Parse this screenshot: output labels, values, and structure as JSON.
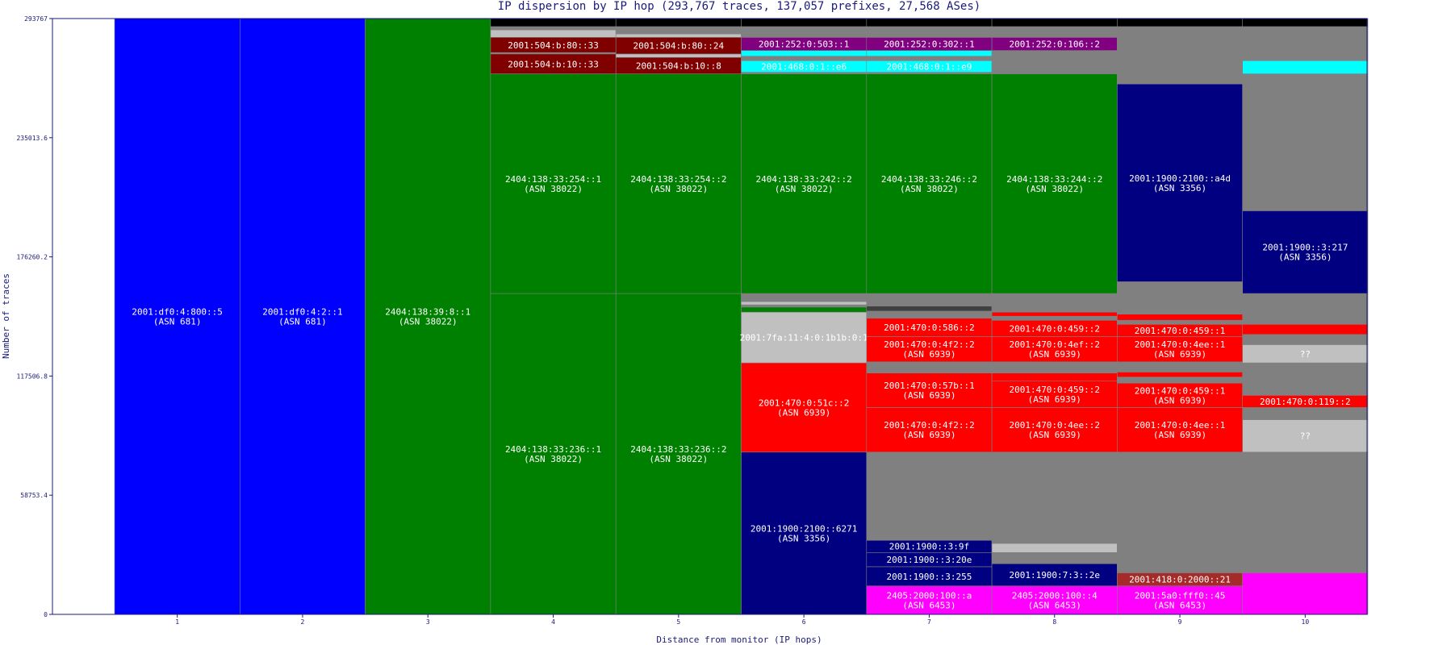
{
  "chart_data": {
    "type": "bar",
    "title": "IP dispersion by IP hop (293,767 traces, 137,057 prefixes, 27,568 ASes)",
    "xlabel": "Distance from monitor (IP hops)",
    "ylabel": "Number of traces",
    "ylim": [
      0,
      293767
    ],
    "yticks": [
      "0",
      "58753.4",
      "117506.8",
      "176260.2",
      "235013.6",
      "293767"
    ],
    "categories": [
      "1",
      "2",
      "3",
      "4",
      "5",
      "6",
      "7",
      "8",
      "9",
      "10"
    ],
    "colors": {
      "blue": "#0000ff",
      "green": "#008000",
      "darkred": "#800000",
      "purple": "#800080",
      "cyan": "#00ffff",
      "navy": "#000080",
      "red": "#ff0000",
      "silver": "#c0c0c0",
      "gray": "#808080",
      "black": "#000000",
      "magenta": "#ff00ff",
      "brown": "#a52a2a",
      "darkgray": "#404040",
      "axis": "#1a1a7a"
    },
    "columns": [
      {
        "hop": "1",
        "segments": [
          {
            "start": 0,
            "end": 293767,
            "color": "blue",
            "lines": [
              "2001:df0:4:800::5",
              "(ASN 681)"
            ]
          }
        ]
      },
      {
        "hop": "2",
        "segments": [
          {
            "start": 0,
            "end": 293767,
            "color": "blue",
            "lines": [
              "2001:df0:4:2::1",
              "(ASN 681)"
            ]
          }
        ]
      },
      {
        "hop": "3",
        "segments": [
          {
            "start": 0,
            "end": 293767,
            "color": "green",
            "lines": [
              "2404:138:39:8::1",
              "(ASN 38022)"
            ]
          }
        ]
      },
      {
        "hop": "4",
        "segments": [
          {
            "start": 0,
            "end": 158200,
            "color": "green",
            "lines": [
              "2404:138:33:236::1",
              "(ASN 38022)"
            ]
          },
          {
            "start": 158200,
            "end": 266500,
            "color": "green",
            "lines": [
              "2404:138:33:254::1",
              "(ASN 38022)"
            ]
          },
          {
            "start": 266500,
            "end": 276300,
            "color": "darkred",
            "lines": [
              "2001:504:b:10::33"
            ]
          },
          {
            "start": 276300,
            "end": 277000,
            "color": "gray",
            "lines": []
          },
          {
            "start": 277000,
            "end": 284500,
            "color": "darkred",
            "lines": [
              "2001:504:b:80::33"
            ]
          },
          {
            "start": 284500,
            "end": 288200,
            "color": "silver",
            "lines": []
          },
          {
            "start": 288200,
            "end": 289800,
            "color": "gray",
            "lines": []
          },
          {
            "start": 289800,
            "end": 293767,
            "color": "black",
            "lines": []
          }
        ]
      },
      {
        "hop": "5",
        "segments": [
          {
            "start": 0,
            "end": 158200,
            "color": "green",
            "lines": [
              "2404:138:33:236::2",
              "(ASN 38022)"
            ]
          },
          {
            "start": 158200,
            "end": 266500,
            "color": "green",
            "lines": [
              "2404:138:33:254::2",
              "(ASN 38022)"
            ]
          },
          {
            "start": 266500,
            "end": 274600,
            "color": "darkred",
            "lines": [
              "2001:504:b:10::8"
            ]
          },
          {
            "start": 274600,
            "end": 276300,
            "color": "silver",
            "lines": []
          },
          {
            "start": 276300,
            "end": 284500,
            "color": "darkred",
            "lines": [
              "2001:504:b:80::24"
            ]
          },
          {
            "start": 284500,
            "end": 286200,
            "color": "silver",
            "lines": []
          },
          {
            "start": 286200,
            "end": 289800,
            "color": "gray",
            "lines": []
          },
          {
            "start": 289800,
            "end": 293767,
            "color": "black",
            "lines": []
          }
        ]
      },
      {
        "hop": "6",
        "segments": [
          {
            "start": 0,
            "end": 80000,
            "color": "navy",
            "lines": [
              "2001:1900:2100::6271",
              "(ASN 3356)"
            ]
          },
          {
            "start": 80000,
            "end": 124000,
            "color": "red",
            "lines": [
              "2001:470:0:51c::2",
              "(ASN 6939)"
            ]
          },
          {
            "start": 124000,
            "end": 149000,
            "color": "silver",
            "lines": [
              "2001:7fa:11:4:0:1b1b:0:1"
            ]
          },
          {
            "start": 149000,
            "end": 151500,
            "color": "green",
            "lines": []
          },
          {
            "start": 151500,
            "end": 152800,
            "color": "gray",
            "lines": []
          },
          {
            "start": 152800,
            "end": 154200,
            "color": "silver",
            "lines": []
          },
          {
            "start": 154200,
            "end": 158200,
            "color": "gray",
            "lines": []
          },
          {
            "start": 158200,
            "end": 266500,
            "color": "green",
            "lines": [
              "2404:138:33:242::2",
              "(ASN 38022)"
            ]
          },
          {
            "start": 266500,
            "end": 267300,
            "color": "gray",
            "lines": []
          },
          {
            "start": 267300,
            "end": 273000,
            "color": "cyan",
            "lines": [
              "2001:468:0:1::e6"
            ]
          },
          {
            "start": 273000,
            "end": 275200,
            "color": "gray",
            "lines": []
          },
          {
            "start": 275200,
            "end": 278000,
            "color": "cyan",
            "lines": []
          },
          {
            "start": 278000,
            "end": 284500,
            "color": "purple",
            "lines": [
              "2001:252:0:503::1"
            ]
          },
          {
            "start": 284500,
            "end": 289800,
            "color": "gray",
            "lines": []
          },
          {
            "start": 289800,
            "end": 293767,
            "color": "black",
            "lines": []
          }
        ]
      },
      {
        "hop": "7",
        "segments": [
          {
            "start": 0,
            "end": 14000,
            "color": "magenta",
            "lines": [
              "2405:2000:100::a",
              "(ASN 6453)"
            ]
          },
          {
            "start": 14000,
            "end": 23500,
            "color": "navy",
            "lines": [
              "2001:1900::3:255"
            ]
          },
          {
            "start": 23500,
            "end": 30500,
            "color": "navy",
            "lines": [
              "2001:1900::3:20e"
            ]
          },
          {
            "start": 30500,
            "end": 36500,
            "color": "navy",
            "lines": [
              "2001:1900::3:9f"
            ]
          },
          {
            "start": 36500,
            "end": 80000,
            "color": "gray",
            "lines": []
          },
          {
            "start": 80000,
            "end": 102000,
            "color": "red",
            "lines": [
              "2001:470:0:4f2::2",
              "(ASN 6939)"
            ]
          },
          {
            "start": 102000,
            "end": 119000,
            "color": "red",
            "lines": [
              "2001:470:0:57b::1",
              "(ASN 6939)"
            ]
          },
          {
            "start": 119000,
            "end": 124500,
            "color": "gray",
            "lines": []
          },
          {
            "start": 124500,
            "end": 137000,
            "color": "red",
            "lines": [
              "2001:470:0:4f2::2",
              "(ASN 6939)"
            ]
          },
          {
            "start": 137000,
            "end": 146000,
            "color": "red",
            "lines": [
              "2001:470:0:586::2"
            ]
          },
          {
            "start": 146000,
            "end": 149500,
            "color": "gray",
            "lines": []
          },
          {
            "start": 149500,
            "end": 152000,
            "color": "darkgray",
            "lines": []
          },
          {
            "start": 152000,
            "end": 158200,
            "color": "gray",
            "lines": []
          },
          {
            "start": 158200,
            "end": 266500,
            "color": "green",
            "lines": [
              "2404:138:33:246::2",
              "(ASN 38022)"
            ]
          },
          {
            "start": 266500,
            "end": 267300,
            "color": "gray",
            "lines": []
          },
          {
            "start": 267300,
            "end": 273000,
            "color": "cyan",
            "lines": [
              "2001:468:0:1::e9"
            ]
          },
          {
            "start": 273000,
            "end": 275200,
            "color": "gray",
            "lines": []
          },
          {
            "start": 275200,
            "end": 278000,
            "color": "cyan",
            "lines": []
          },
          {
            "start": 278000,
            "end": 284500,
            "color": "purple",
            "lines": [
              "2001:252:0:302::1"
            ]
          },
          {
            "start": 284500,
            "end": 289800,
            "color": "gray",
            "lines": []
          },
          {
            "start": 289800,
            "end": 293767,
            "color": "black",
            "lines": []
          }
        ]
      },
      {
        "hop": "8",
        "segments": [
          {
            "start": 0,
            "end": 14000,
            "color": "magenta",
            "lines": [
              "2405:2000:100::4",
              "(ASN 6453)"
            ]
          },
          {
            "start": 14000,
            "end": 25000,
            "color": "navy",
            "lines": [
              "2001:1900:7:3::2e"
            ]
          },
          {
            "start": 25000,
            "end": 30500,
            "color": "gray",
            "lines": []
          },
          {
            "start": 30500,
            "end": 35000,
            "color": "silver",
            "lines": []
          },
          {
            "start": 35000,
            "end": 80000,
            "color": "gray",
            "lines": []
          },
          {
            "start": 80000,
            "end": 102000,
            "color": "red",
            "lines": [
              "2001:470:0:4ee::2",
              "(ASN 6939)"
            ]
          },
          {
            "start": 102000,
            "end": 115000,
            "color": "red",
            "lines": [
              "2001:470:0:459::2",
              "(ASN 6939)"
            ]
          },
          {
            "start": 115000,
            "end": 119000,
            "color": "red",
            "lines": []
          },
          {
            "start": 119000,
            "end": 124500,
            "color": "gray",
            "lines": []
          },
          {
            "start": 124500,
            "end": 137000,
            "color": "red",
            "lines": [
              "2001:470:0:4ef::2",
              "(ASN 6939)"
            ]
          },
          {
            "start": 137000,
            "end": 145000,
            "color": "red",
            "lines": [
              "2001:470:0:459::2"
            ]
          },
          {
            "start": 145000,
            "end": 147000,
            "color": "gray",
            "lines": []
          },
          {
            "start": 147000,
            "end": 149000,
            "color": "red",
            "lines": []
          },
          {
            "start": 149000,
            "end": 158200,
            "color": "gray",
            "lines": []
          },
          {
            "start": 158200,
            "end": 266500,
            "color": "green",
            "lines": [
              "2404:138:33:244::2",
              "(ASN 38022)"
            ]
          },
          {
            "start": 266500,
            "end": 278000,
            "color": "gray",
            "lines": []
          },
          {
            "start": 278000,
            "end": 284500,
            "color": "purple",
            "lines": [
              "2001:252:0:106::2"
            ]
          },
          {
            "start": 284500,
            "end": 289800,
            "color": "gray",
            "lines": []
          },
          {
            "start": 289800,
            "end": 293767,
            "color": "black",
            "lines": []
          }
        ]
      },
      {
        "hop": "9",
        "segments": [
          {
            "start": 0,
            "end": 14000,
            "color": "magenta",
            "lines": [
              "2001:5a0:fff0::45",
              "(ASN 6453)"
            ]
          },
          {
            "start": 14000,
            "end": 20500,
            "color": "brown",
            "lines": [
              "2001:418:0:2000::21"
            ]
          },
          {
            "start": 20500,
            "end": 80000,
            "color": "gray",
            "lines": []
          },
          {
            "start": 80000,
            "end": 102000,
            "color": "red",
            "lines": [
              "2001:470:0:4ee::1",
              "(ASN 6939)"
            ]
          },
          {
            "start": 102000,
            "end": 114000,
            "color": "red",
            "lines": [
              "2001:470:0:459::1",
              "(ASN 6939)"
            ]
          },
          {
            "start": 114000,
            "end": 117000,
            "color": "gray",
            "lines": []
          },
          {
            "start": 117000,
            "end": 119500,
            "color": "red",
            "lines": []
          },
          {
            "start": 119500,
            "end": 124500,
            "color": "gray",
            "lines": []
          },
          {
            "start": 124500,
            "end": 137000,
            "color": "red",
            "lines": [
              "2001:470:0:4ee::1",
              "(ASN 6939)"
            ]
          },
          {
            "start": 137000,
            "end": 143000,
            "color": "red",
            "lines": [
              "2001:470:0:459::1"
            ]
          },
          {
            "start": 143000,
            "end": 145000,
            "color": "gray",
            "lines": []
          },
          {
            "start": 145000,
            "end": 148000,
            "color": "red",
            "lines": []
          },
          {
            "start": 148000,
            "end": 261500,
            "color": "gray",
            "lines": []
          },
          {
            "start": 261500,
            "end": 261501,
            "color": "gray",
            "lines": []
          },
          {
            "start": 164000,
            "end": 261500,
            "color": "navy",
            "lines": [
              "2001:1900:2100::a4d",
              "(ASN 3356)"
            ]
          },
          {
            "start": 261500,
            "end": 266500,
            "color": "gray",
            "lines": []
          },
          {
            "start": 266500,
            "end": 278000,
            "color": "gray",
            "lines": []
          },
          {
            "start": 278000,
            "end": 284500,
            "color": "gray",
            "lines": []
          },
          {
            "start": 284500,
            "end": 289800,
            "color": "gray",
            "lines": []
          },
          {
            "start": 289800,
            "end": 293767,
            "color": "black",
            "lines": []
          }
        ]
      },
      {
        "hop": "10",
        "segments": [
          {
            "start": 0,
            "end": 20500,
            "color": "magenta",
            "lines": []
          },
          {
            "start": 20500,
            "end": 80000,
            "color": "gray",
            "lines": []
          },
          {
            "start": 80000,
            "end": 96000,
            "color": "silver",
            "lines": [
              "??"
            ]
          },
          {
            "start": 96000,
            "end": 102000,
            "color": "gray",
            "lines": []
          },
          {
            "start": 102000,
            "end": 108000,
            "color": "red",
            "lines": [
              "2001:470:0:119::2"
            ]
          },
          {
            "start": 108000,
            "end": 124000,
            "color": "gray",
            "lines": []
          },
          {
            "start": 124000,
            "end": 133000,
            "color": "silver",
            "lines": [
              "??"
            ]
          },
          {
            "start": 133000,
            "end": 138000,
            "color": "gray",
            "lines": []
          },
          {
            "start": 138000,
            "end": 143000,
            "color": "red",
            "lines": []
          },
          {
            "start": 143000,
            "end": 158200,
            "color": "gray",
            "lines": []
          },
          {
            "start": 158200,
            "end": 199000,
            "color": "navy",
            "lines": [
              "2001:1900::3:217",
              "(ASN 3356)"
            ]
          },
          {
            "start": 199000,
            "end": 266500,
            "color": "gray",
            "lines": []
          },
          {
            "start": 266500,
            "end": 273000,
            "color": "cyan",
            "lines": []
          },
          {
            "start": 273000,
            "end": 289800,
            "color": "gray",
            "lines": []
          },
          {
            "start": 289800,
            "end": 293767,
            "color": "black",
            "lines": []
          }
        ]
      }
    ]
  }
}
